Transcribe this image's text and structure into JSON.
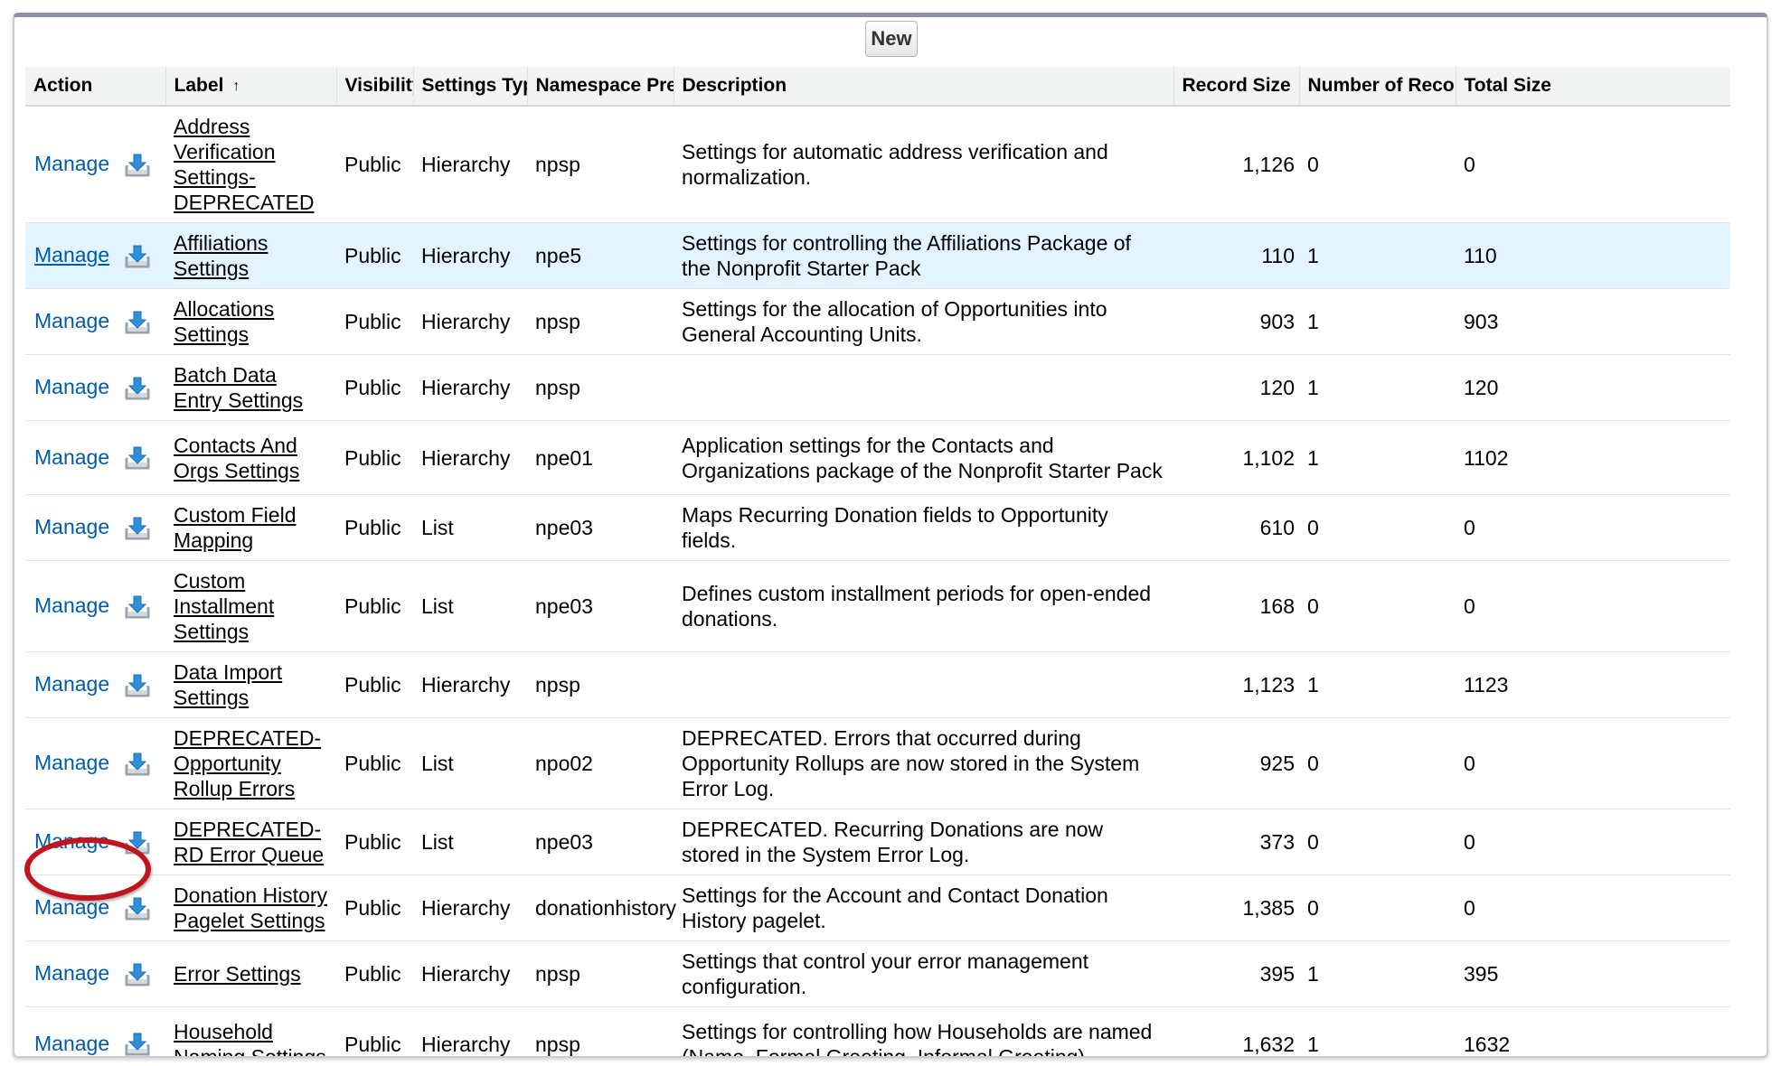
{
  "toolbar": {
    "new_label": "New"
  },
  "columns": {
    "action": "Action",
    "label": "Label",
    "label_sort": "↑",
    "visibility": "Visibility",
    "settings_type": "Settings Type",
    "namespace": "Namespace Prefix",
    "description": "Description",
    "record_size": "Record Size",
    "num_records": "Number of Records",
    "total_size": "Total Size"
  },
  "manage_label": "Manage",
  "rows": [
    {
      "label": "Address Verification Settings-DEPRECATED",
      "visibility": "Public",
      "type": "Hierarchy",
      "ns": "npsp",
      "desc": "Settings for automatic address verification and normalization.",
      "record_size": "1,126",
      "num_records": "0",
      "total_size": "0"
    },
    {
      "label": "Affiliations Settings",
      "visibility": "Public",
      "type": "Hierarchy",
      "ns": "npe5",
      "desc": "Settings for controlling the Affiliations Package of the Nonprofit Starter Pack",
      "record_size": "110",
      "num_records": "1",
      "total_size": "110"
    },
    {
      "label": "Allocations Settings",
      "visibility": "Public",
      "type": "Hierarchy",
      "ns": "npsp",
      "desc": "Settings for the allocation of Opportunities into General Accounting Units.",
      "record_size": "903",
      "num_records": "1",
      "total_size": "903"
    },
    {
      "label": "Batch Data Entry Settings",
      "visibility": "Public",
      "type": "Hierarchy",
      "ns": "npsp",
      "desc": "",
      "record_size": "120",
      "num_records": "1",
      "total_size": "120"
    },
    {
      "label": "Contacts And Orgs Settings",
      "visibility": "Public",
      "type": "Hierarchy",
      "ns": "npe01",
      "desc": "Application settings for the Contacts and Organizations package of the Nonprofit Starter Pack",
      "record_size": "1,102",
      "num_records": "1",
      "total_size": "1102"
    },
    {
      "label": "Custom Field Mapping",
      "visibility": "Public",
      "type": "List",
      "ns": "npe03",
      "desc": "Maps Recurring Donation fields to Opportunity fields.",
      "record_size": "610",
      "num_records": "0",
      "total_size": "0"
    },
    {
      "label": "Custom Installment Settings",
      "visibility": "Public",
      "type": "List",
      "ns": "npe03",
      "desc": "Defines custom installment periods for open-ended donations.",
      "record_size": "168",
      "num_records": "0",
      "total_size": "0"
    },
    {
      "label": "Data Import Settings",
      "visibility": "Public",
      "type": "Hierarchy",
      "ns": "npsp",
      "desc": "",
      "record_size": "1,123",
      "num_records": "1",
      "total_size": "1123"
    },
    {
      "label": "DEPRECATED-Opportunity Rollup Errors",
      "visibility": "Public",
      "type": "List",
      "ns": "npo02",
      "desc": "DEPRECATED. Errors that occurred during Opportunity Rollups are now stored in the System Error Log.",
      "record_size": "925",
      "num_records": "0",
      "total_size": "0"
    },
    {
      "label": "DEPRECATED-RD Error Queue",
      "visibility": "Public",
      "type": "List",
      "ns": "npe03",
      "desc": "DEPRECATED. Recurring Donations are now stored in the System Error Log.",
      "record_size": "373",
      "num_records": "0",
      "total_size": "0"
    },
    {
      "label": "Donation History Pagelet Settings",
      "visibility": "Public",
      "type": "Hierarchy",
      "ns": "donationhistory",
      "desc": "Settings for the Account and Contact Donation History pagelet.",
      "record_size": "1,385",
      "num_records": "0",
      "total_size": "0"
    },
    {
      "label": "Error Settings",
      "visibility": "Public",
      "type": "Hierarchy",
      "ns": "npsp",
      "desc": "Settings that control your error management configuration.",
      "record_size": "395",
      "num_records": "1",
      "total_size": "395"
    },
    {
      "label": "Household Naming Settings",
      "visibility": "Public",
      "type": "Hierarchy",
      "ns": "npsp",
      "desc": "Settings for controlling how Households are named (Name, Formal Greeting, Informal Greeting).",
      "record_size": "1,632",
      "num_records": "1",
      "total_size": "1632"
    }
  ],
  "colors": {
    "link": "#015ba7",
    "highlight_row": "#e3f3ff",
    "annotation_circle": "#c0141e"
  },
  "icons": {
    "row_action": "download-icon",
    "sort": "sort-ascending-icon"
  }
}
